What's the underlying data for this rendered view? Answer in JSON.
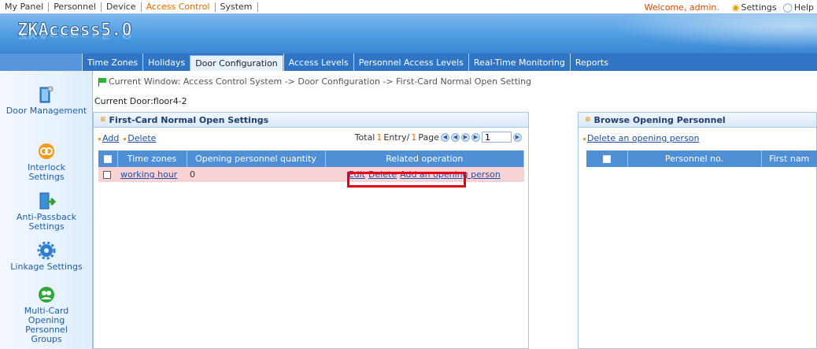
{
  "top_menu": {
    "items": [
      "My Panel",
      "Personnel",
      "Device",
      "Access Control",
      "System"
    ],
    "welcome": "Welcome, admin.",
    "settings": "Settings",
    "help": "Help"
  },
  "banner": {
    "logo": "ZKAccess5.0"
  },
  "tabs": [
    "Time Zones",
    "Holidays",
    "Door Configuration",
    "Access Levels",
    "Personnel Access Levels",
    "Real-Time Monitoring",
    "Reports"
  ],
  "sidebar": {
    "items": [
      {
        "label": "Door Management",
        "icon": "door-icon"
      },
      {
        "label": "Interlock Settings",
        "icon": "interlock-icon"
      },
      {
        "label": "Anti-Passback Settings",
        "icon": "anti-passback-icon"
      },
      {
        "label": "Linkage Settings",
        "icon": "gear-icon"
      },
      {
        "label": "Multi-Card Opening Personnel Groups",
        "icon": "group-icon"
      }
    ]
  },
  "breadcrumb": "Current Window: Access Control System -> Door Configuration -> First-Card Normal Open Setting",
  "current_door": "Current Door:floor4-2",
  "left_panel": {
    "title": "First-Card Normal Open Settings",
    "add": "Add",
    "delete": "Delete",
    "pager": {
      "total_label": "Total",
      "total_num": "1",
      "entry_label": "Entry/",
      "pages_num": "1",
      "page_label": "Page",
      "current_page": "1"
    },
    "columns": [
      "Time zones",
      "Opening personnel quantity",
      "Related operation"
    ],
    "rows": [
      {
        "time_zone": "working hour",
        "quantity": "0",
        "ops": [
          "Edit",
          "Delete",
          "Add an opening person"
        ]
      }
    ]
  },
  "right_panel": {
    "title": "Browse Opening Personnel",
    "delete_link": "Delete an opening person",
    "columns": [
      "Personnel no.",
      "First nam"
    ]
  },
  "colors": {
    "accent": "#2f75c4",
    "highlight": "#e50012",
    "row_bg": "#f9d2d6"
  }
}
